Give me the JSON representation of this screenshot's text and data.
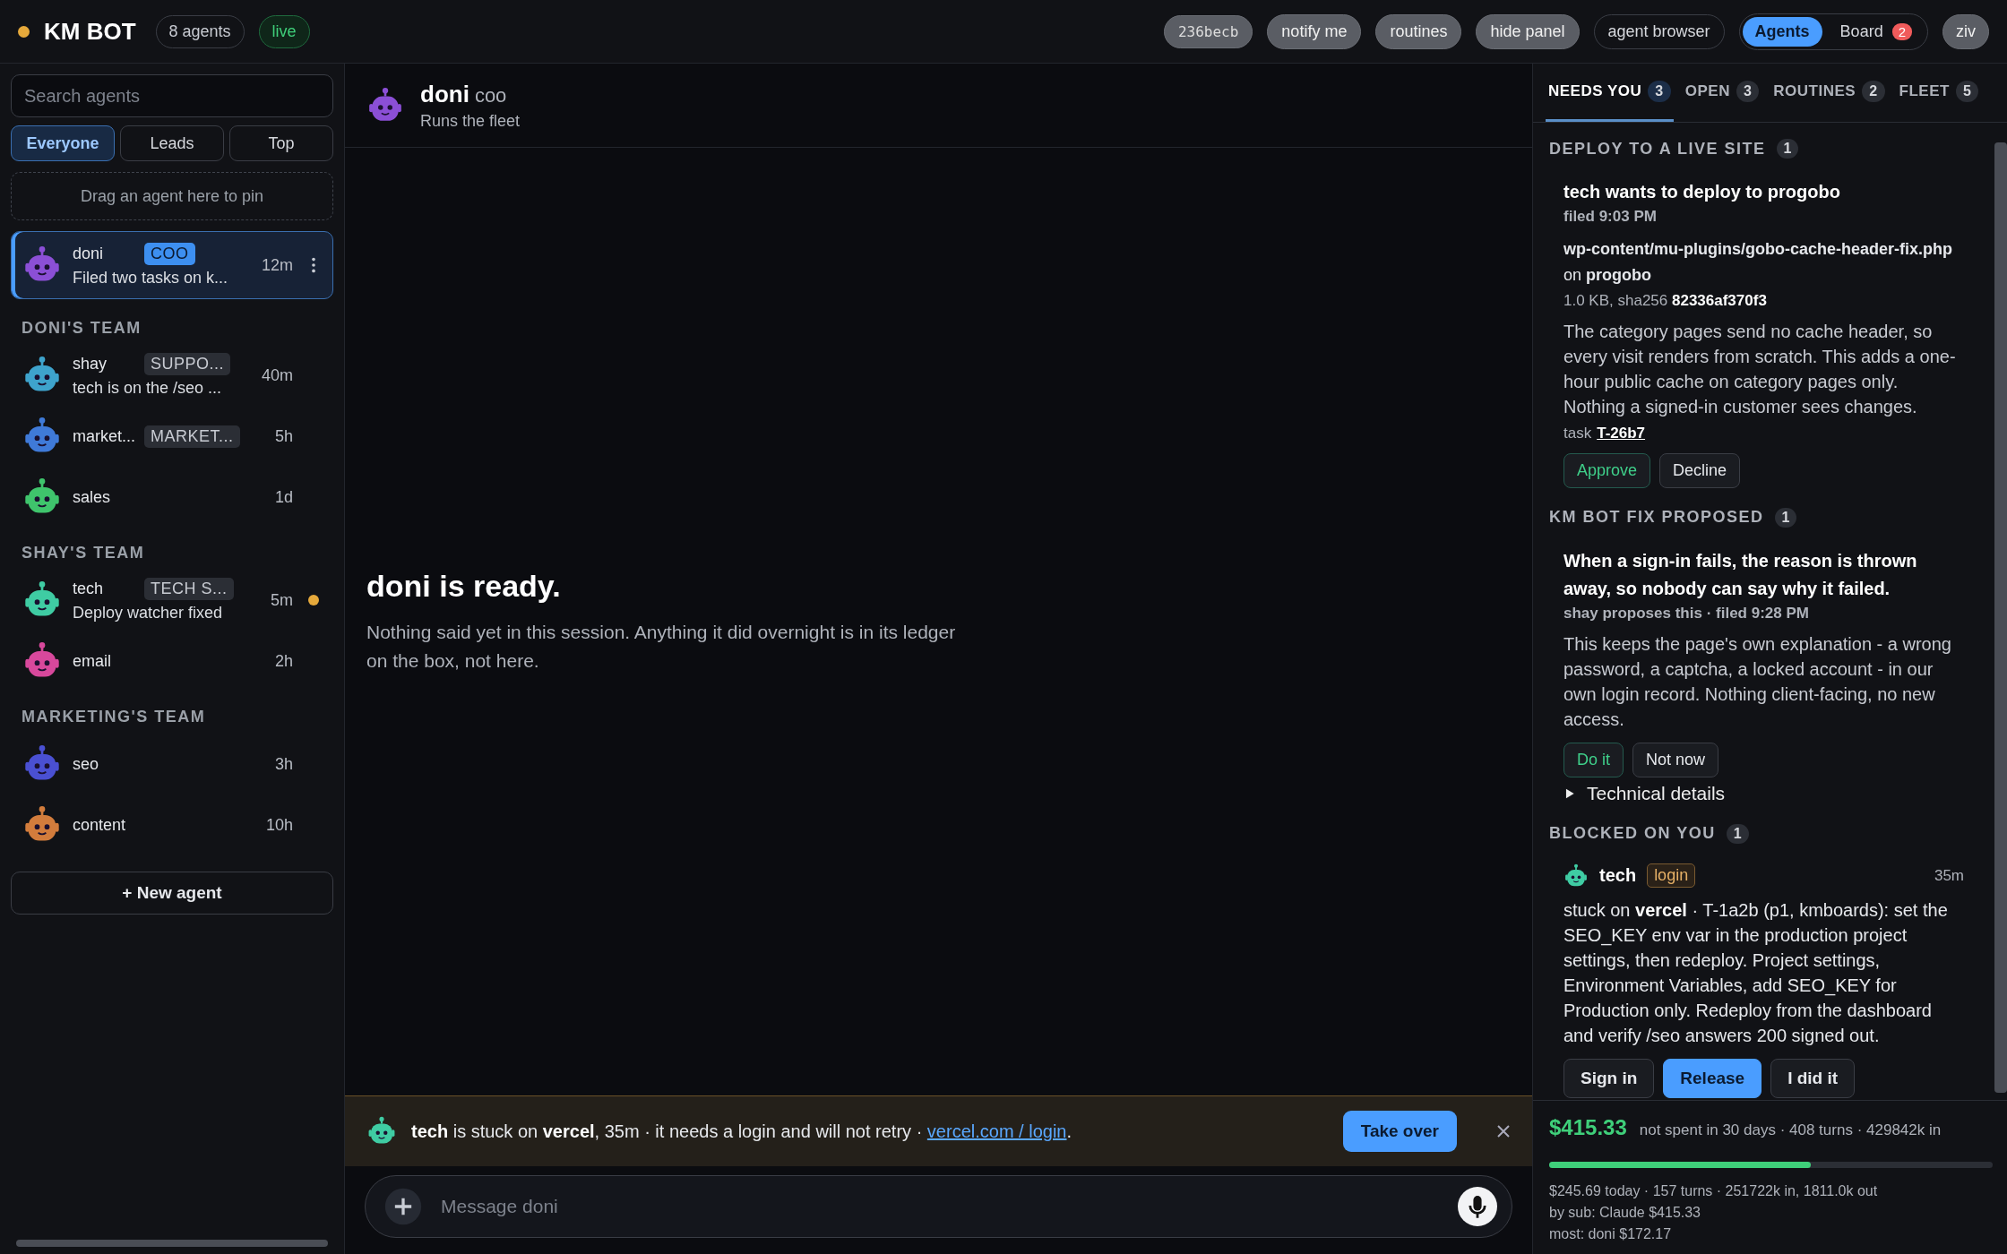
{
  "header": {
    "logo": "KM BOT",
    "agent_count": "8 agents",
    "live_badge": "live",
    "actions": [
      {
        "label": "236becb",
        "kind": "commit"
      },
      {
        "label": "notify me",
        "kind": "pill"
      },
      {
        "label": "routines",
        "kind": "pill"
      },
      {
        "label": "hide panel",
        "kind": "pill"
      },
      {
        "label": "agent browser",
        "kind": "outline"
      }
    ],
    "views": [
      {
        "label": "Agents",
        "selected": true
      },
      {
        "label": "Board",
        "selected": false,
        "badge": "2"
      }
    ],
    "user": "ziv"
  },
  "sidebar": {
    "search": {
      "placeholder": "Search agents"
    },
    "filters": [
      {
        "label": "Everyone",
        "selected": true
      },
      {
        "label": "Leads",
        "selected": false
      },
      {
        "label": "Top",
        "selected": false
      }
    ],
    "pin_zone": "Drag an agent here to pin",
    "agents": [
      {
        "name": "doni",
        "role": "COO",
        "preview": "Filed two tasks on k...",
        "time": "12m",
        "color": "#8b4fd6",
        "selected": true,
        "unread": false
      }
    ],
    "teams": [
      {
        "title": "DONI'S TEAM",
        "agents": [
          {
            "name": "shay",
            "role": "SUPPO...",
            "preview": "tech is on the /seo ...",
            "time": "40m",
            "color": "#3ea3cc",
            "selected": false,
            "unread": false
          },
          {
            "name": "market...",
            "role": "MARKET...",
            "time": "5h",
            "color": "#3f7ad8",
            "selected": false,
            "unread": false
          },
          {
            "name": "sales",
            "time": "1d",
            "color": "#3fc46c",
            "selected": false,
            "unread": false
          }
        ]
      },
      {
        "title": "SHAY'S TEAM",
        "agents": [
          {
            "name": "tech",
            "role": "TECH S...",
            "preview": "Deploy watcher fixed",
            "time": "5m",
            "color": "#3fcca3",
            "selected": false,
            "unread": true
          },
          {
            "name": "email",
            "time": "2h",
            "color": "#d8489c",
            "selected": false,
            "unread": false
          }
        ]
      },
      {
        "title": "MARKETING'S TEAM",
        "agents": [
          {
            "name": "seo",
            "time": "3h",
            "color": "#4a50d2",
            "selected": false,
            "unread": false
          },
          {
            "name": "content",
            "time": "10h",
            "color": "#d27c3c",
            "selected": false,
            "unread": false
          }
        ]
      }
    ],
    "new_agent": "+ New agent"
  },
  "chat": {
    "agent": {
      "name": "doni",
      "role": "coo",
      "subtitle": "Runs the fleet",
      "color": "#8b4fd6"
    },
    "empty_title": "doni is ready.",
    "empty_text": "Nothing said yet in this session. Anything it did overnight is in its ledger on the box, not here.",
    "banner": {
      "text": "**tech** is stuck on **vercel**, 35m · it needs a login and will not retry · ",
      "link": "vercel.com / login",
      "tail": ".",
      "button": "Take over"
    },
    "composer": {
      "placeholder": "Message doni"
    }
  },
  "panel": {
    "tabs": [
      {
        "label": "NEEDS YOU",
        "count": "3",
        "selected": true
      },
      {
        "label": "OPEN",
        "count": "3",
        "selected": false
      },
      {
        "label": "ROUTINES",
        "count": "2",
        "selected": false
      },
      {
        "label": "FLEET",
        "count": "5",
        "selected": false
      }
    ],
    "sections": [
      {
        "title": "DEPLOY TO A LIVE SITE",
        "count": "1",
        "card": {
          "kind": "deploy",
          "title": "tech wants to deploy to progobo",
          "meta": "filed 9:03 PM",
          "path": "**wp-content/mu-plugins/gobo-cache-header-fix.php** on **progobo**",
          "size": "1.0 KB, sha256 **82336af370f3**",
          "description": "The category pages send no cache header, so every visit renders from scratch. This adds a one-hour public cache on category pages only. Nothing a signed-in customer sees changes.",
          "task_label": "task",
          "task": "T-26b7",
          "buttons": [
            {
              "label": "Approve",
              "kind": "go"
            },
            {
              "label": "Decline",
              "kind": "plain"
            }
          ]
        }
      },
      {
        "title": "KM BOT FIX PROPOSED",
        "count": "1",
        "card": {
          "kind": "proposal",
          "title": "When a sign-in fails, the reason is thrown away, so nobody can say why it failed.",
          "meta": "shay proposes this · filed 9:28 PM",
          "description": "This keeps the page's own explanation - a wrong password, a captcha, a locked account - in our own login record. Nothing client-facing, no new access.",
          "buttons": [
            {
              "label": "Do it",
              "kind": "go"
            },
            {
              "label": "Not now",
              "kind": "plain"
            }
          ],
          "details": {
            "label": "Technical details",
            "expanded": false
          }
        }
      },
      {
        "title": "BLOCKED ON YOU",
        "count": "1",
        "card": {
          "kind": "blocked",
          "agent": "tech",
          "tag": "login",
          "time": "35m",
          "text": "stuck on **vercel** · T-1a2b (p1, kmboards): set the SEO_KEY env var in the production project settings, then redeploy. Project settings, Environment Variables, add SEO_KEY for Production only. Redeploy from the dashboard and verify /seo answers 200 signed out.",
          "buttons": [
            {
              "label": "Sign in",
              "kind": "plain"
            },
            {
              "label": "Release",
              "kind": "primary"
            },
            {
              "label": "I did it",
              "kind": "plain"
            }
          ]
        }
      }
    ],
    "spend": {
      "amount": "$415.33",
      "summary": "not spent in 30 days · 408 turns · 429842k in",
      "level": 0.59,
      "lines": [
        "$245.69 today · 157 turns · 251722k in, 1811.0k out",
        "by sub: Claude $415.33",
        "most: doni $172.17"
      ]
    }
  }
}
